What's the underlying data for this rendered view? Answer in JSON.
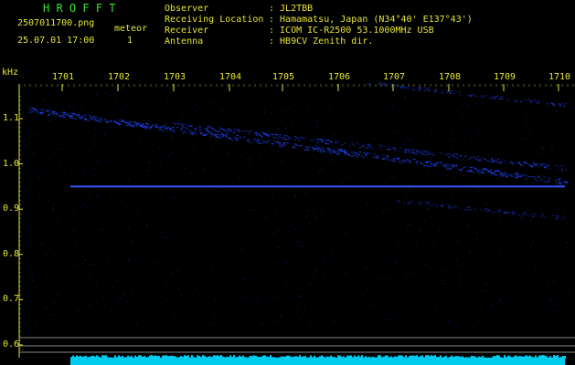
{
  "header": {
    "app_name": "H R O F F T",
    "filename": "2507011700.png",
    "datetime": "25.07.01 17:00",
    "meteor_label": "meteor",
    "meteor_count": "1"
  },
  "station": {
    "rows": [
      {
        "label": "Observer",
        "value": ": JL2TBB"
      },
      {
        "label": "Receiving Location",
        "value": ": Hamamatsu, Japan (N34°40' E137°43')"
      },
      {
        "label": "Receiver",
        "value": ": ICOM IC-R2500 53.1000MHz USB"
      },
      {
        "label": "Antenna",
        "value": ": HB9CV Zenith dir."
      }
    ]
  },
  "spectrogram": {
    "unit_label": "kHz",
    "time_ticks": [
      "1701",
      "1702",
      "1703",
      "1704",
      "1705",
      "1706",
      "1707",
      "1708",
      "1709",
      "1710"
    ],
    "freq_ticks": [
      "1.1",
      "1.0",
      "0.9",
      "0.8",
      "0.7",
      "0.6"
    ],
    "carrier_freq_khz": 0.95,
    "colors": {
      "background": "#000000",
      "text_green": "#33e633",
      "text_yellow": "#e6e633",
      "signal": "#2244ff",
      "noise_band": "#00ccee",
      "grid": "#888888"
    }
  }
}
